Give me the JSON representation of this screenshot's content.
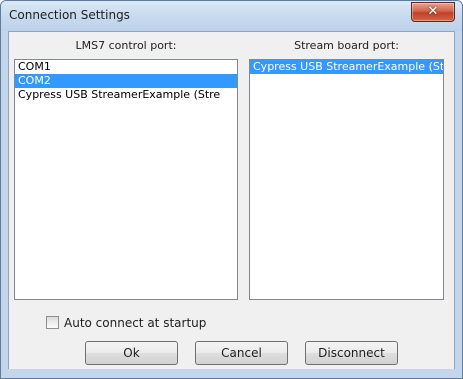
{
  "window": {
    "title": "Connection Settings",
    "close_glyph": "✕"
  },
  "left_pane": {
    "label": "LMS7 control port:",
    "items": [
      "COM1",
      "COM2",
      "Cypress USB StreamerExample (Stre"
    ],
    "selected_index": 1
  },
  "right_pane": {
    "label": "Stream board port:",
    "items": [
      "Cypress USB StreamerExample (Stre"
    ],
    "selected_index": 0
  },
  "auto_connect": {
    "label": "Auto connect at startup",
    "checked": false
  },
  "buttons": {
    "ok": "Ok",
    "cancel": "Cancel",
    "disconnect": "Disconnect"
  },
  "colors": {
    "selection": "#3399ff",
    "frame": "#c3d6ec",
    "close": "#c13f27"
  }
}
